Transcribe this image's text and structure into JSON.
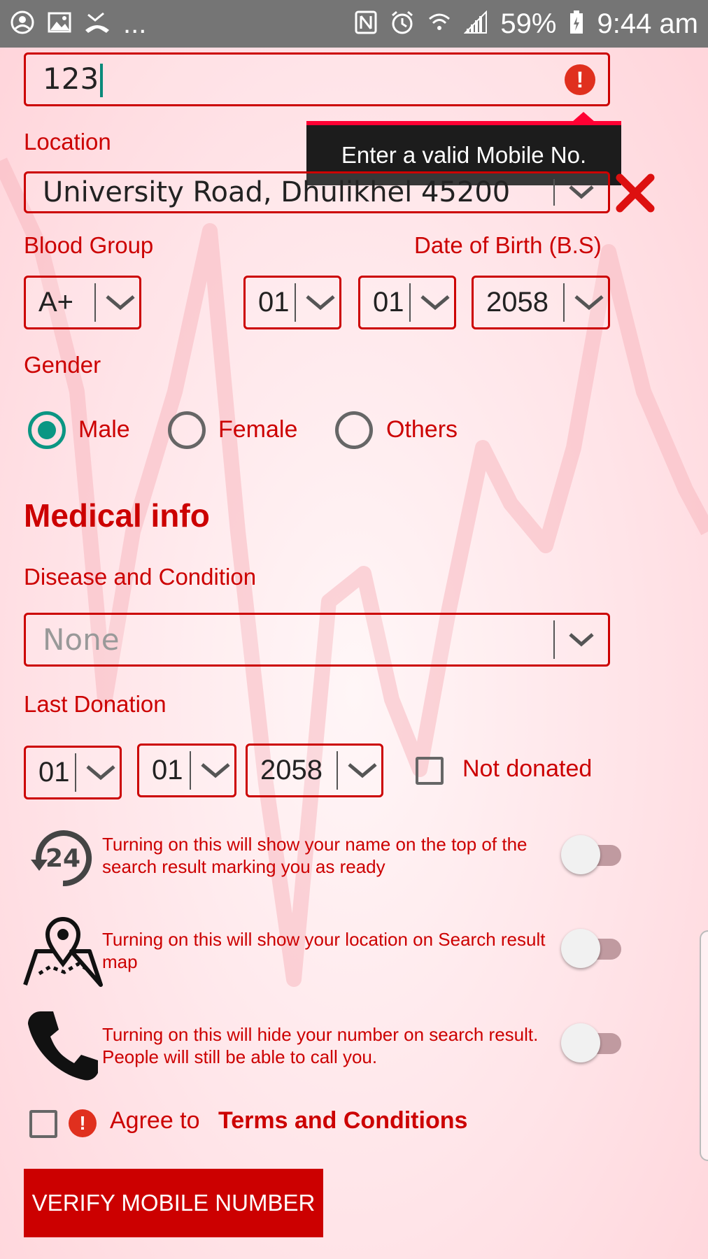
{
  "status_bar": {
    "battery": "59%",
    "time": "9:44 am",
    "overflow": "...",
    "left_icons": [
      "account-icon",
      "image-icon",
      "missed-call-icon"
    ],
    "right_icons": [
      "nfc-icon",
      "alarm-icon",
      "wifi-icon",
      "signal-icon",
      "battery-icon"
    ]
  },
  "mobile": {
    "value": "123",
    "error_tooltip": "Enter a valid Mobile No."
  },
  "location": {
    "label": "Location",
    "value": "University Road, Dhulikhel 45200"
  },
  "blood_group": {
    "label": "Blood Group",
    "value": "A+"
  },
  "dob": {
    "label": "Date of Birth (B.S)",
    "month": "01",
    "day": "01",
    "year": "2058"
  },
  "gender": {
    "label": "Gender",
    "options": [
      "Male",
      "Female",
      "Others"
    ],
    "selected": "Male"
  },
  "medical": {
    "heading": "Medical info",
    "disease_label": "Disease and Condition",
    "disease_placeholder": "None"
  },
  "last_donation": {
    "label": "Last Donation",
    "month": "01",
    "day": "01",
    "year": "2058",
    "not_donated_label": "Not donated",
    "not_donated_checked": false
  },
  "toggles": [
    {
      "icon": "24-hour-icon",
      "text": "Turning on this will show your name on the top of the search result marking you as ready",
      "on": false
    },
    {
      "icon": "map-pin-icon",
      "text": "Turning on this will show your location on Search result map",
      "on": false
    },
    {
      "icon": "phone-icon",
      "text": "Turning on this will hide your number on search result. People will still be able to call you.",
      "on": false
    }
  ],
  "terms": {
    "agree_label": "Agree to",
    "link": "Terms and Conditions",
    "checked": false
  },
  "verify_button": "VERIFY MOBILE NUMBER",
  "colors": {
    "accent": "#cc0000",
    "radio_on": "#0a9683",
    "error": "#e0301e"
  }
}
